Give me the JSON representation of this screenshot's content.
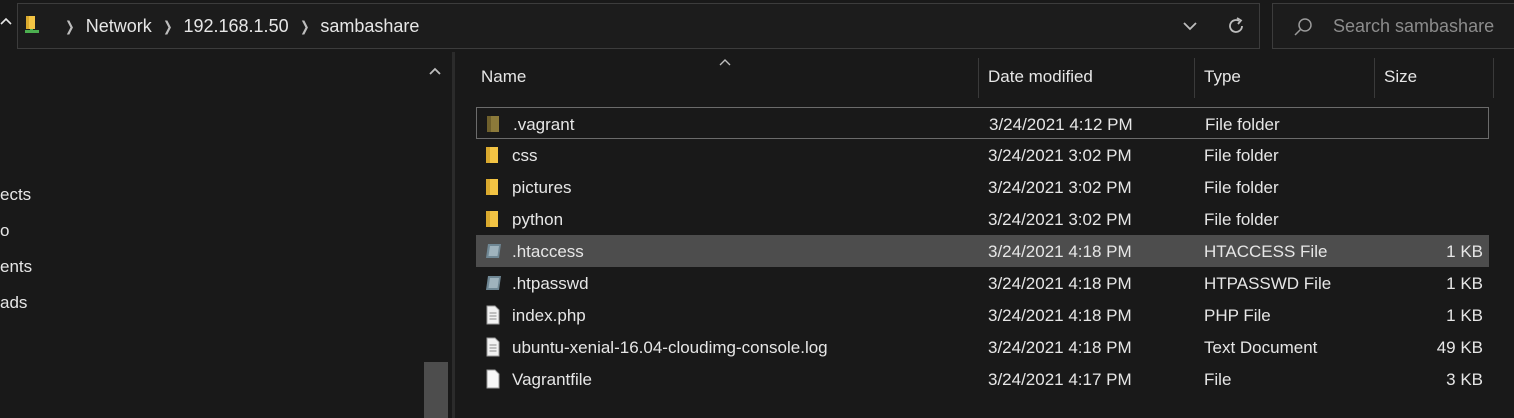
{
  "address": {
    "breadcrumbs": [
      "Network",
      "192.168.1.50",
      "sambashare"
    ]
  },
  "search": {
    "placeholder": "Search sambashare"
  },
  "nav": {
    "items": [
      "ects",
      "o",
      "ents",
      "ads"
    ]
  },
  "columns": {
    "name": "Name",
    "date": "Date modified",
    "type": "Type",
    "size": "Size"
  },
  "files": [
    {
      "name": ".vagrant",
      "date": "3/24/2021 4:12 PM",
      "type": "File folder",
      "size": "",
      "icon": "folder-icon"
    },
    {
      "name": "css",
      "date": "3/24/2021 3:02 PM",
      "type": "File folder",
      "size": "",
      "icon": "folder-icon"
    },
    {
      "name": "pictures",
      "date": "3/24/2021 3:02 PM",
      "type": "File folder",
      "size": "",
      "icon": "folder-icon"
    },
    {
      "name": "python",
      "date": "3/24/2021 3:02 PM",
      "type": "File folder",
      "size": "",
      "icon": "folder-icon"
    },
    {
      "name": ".htaccess",
      "date": "3/24/2021 4:18 PM",
      "type": "HTACCESS File",
      "size": "1 KB",
      "icon": "config-file-icon"
    },
    {
      "name": ".htpasswd",
      "date": "3/24/2021 4:18 PM",
      "type": "HTPASSWD File",
      "size": "1 KB",
      "icon": "config-file-icon"
    },
    {
      "name": "index.php",
      "date": "3/24/2021 4:18 PM",
      "type": "PHP File",
      "size": "1 KB",
      "icon": "document-icon"
    },
    {
      "name": "ubuntu-xenial-16.04-cloudimg-console.log",
      "date": "3/24/2021 4:18 PM",
      "type": "Text Document",
      "size": "49 KB",
      "icon": "document-icon"
    },
    {
      "name": "Vagrantfile",
      "date": "3/24/2021 4:17 PM",
      "type": "File",
      "size": "3 KB",
      "icon": "blank-file-icon"
    }
  ],
  "colors": {
    "background": "#191919",
    "selected_row": "#4d4d4d",
    "folder": "#f3c444"
  }
}
